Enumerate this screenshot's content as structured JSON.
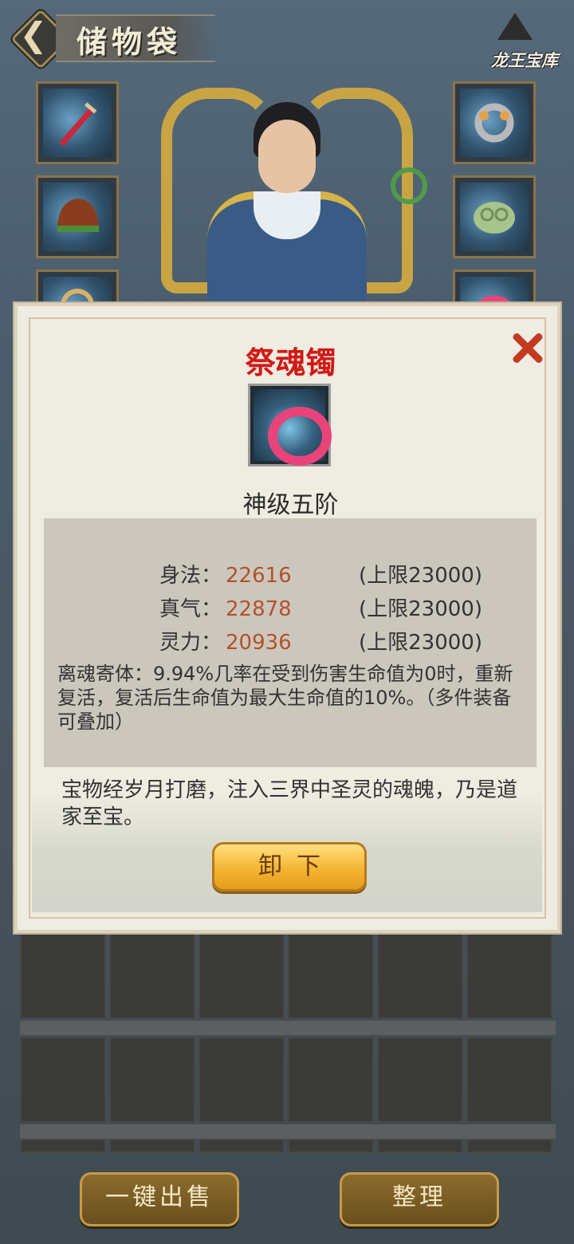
{
  "header": {
    "title": "储物袋",
    "badge_text": "龙王宝库",
    "back_icon": "chevron-left-icon"
  },
  "equipment_slots": {
    "left": [
      "sword-icon",
      "helmet-icon",
      "pendant-icon"
    ],
    "right": [
      "ring-icon",
      "jade-armor-icon",
      "bracelet-icon"
    ]
  },
  "item_detail": {
    "name": "祭魂镯",
    "icon": "bracelet-icon",
    "grade": "神级五阶",
    "attributes": [
      {
        "label": "身法：",
        "value": "22616",
        "limit": "(上限23000)"
      },
      {
        "label": "真气：",
        "value": "22878",
        "limit": "(上限23000)"
      },
      {
        "label": "灵力：",
        "value": "20936",
        "limit": "(上限23000)"
      }
    ],
    "effect": "离魂寄体：9.94%几率在受到伤害生命值为0时，重新复活，复活后生命值为最大生命值的10%。（多件装备可叠加）",
    "description": "宝物经岁月打磨，注入三界中圣灵的魂魄，乃是道家至宝。",
    "unequip_label": "卸下",
    "colors": {
      "name": "#d11a17",
      "value": "#b4512b",
      "close": "#c33a22"
    }
  },
  "footer": {
    "sell_label": "一键出售",
    "sort_label": "整理"
  }
}
